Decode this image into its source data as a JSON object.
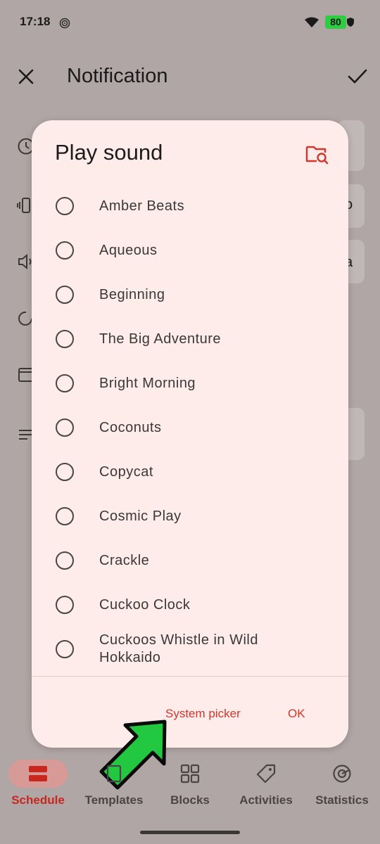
{
  "status_bar": {
    "time": "17:18",
    "battery": "80"
  },
  "header": {
    "title": "Notification"
  },
  "background": {
    "card_texts": [
      "o",
      "a"
    ]
  },
  "dialog": {
    "title": "Play sound",
    "sounds": [
      "Amber Beats",
      "Aqueous",
      "Beginning",
      "The Big Adventure",
      "Bright Morning",
      "Coconuts",
      "Copycat",
      "Cosmic Play",
      "Crackle",
      "Cuckoo Clock",
      "Cuckoos Whistle in Wild\nHokkaido"
    ],
    "system_picker_label": "System picker",
    "ok_label": "OK"
  },
  "bottom_nav": [
    {
      "label": "Schedule",
      "icon": "schedule-icon",
      "active": true
    },
    {
      "label": "Templates",
      "icon": "templates-icon",
      "active": false
    },
    {
      "label": "Blocks",
      "icon": "blocks-icon",
      "active": false
    },
    {
      "label": "Activities",
      "icon": "tag-icon",
      "active": false
    },
    {
      "label": "Statistics",
      "icon": "statistics-icon",
      "active": false
    }
  ],
  "colors": {
    "accent": "#d2372c",
    "dialog_bg": "#fdecea",
    "scrim": "#b0a6a5",
    "arrow": "#22c840"
  }
}
